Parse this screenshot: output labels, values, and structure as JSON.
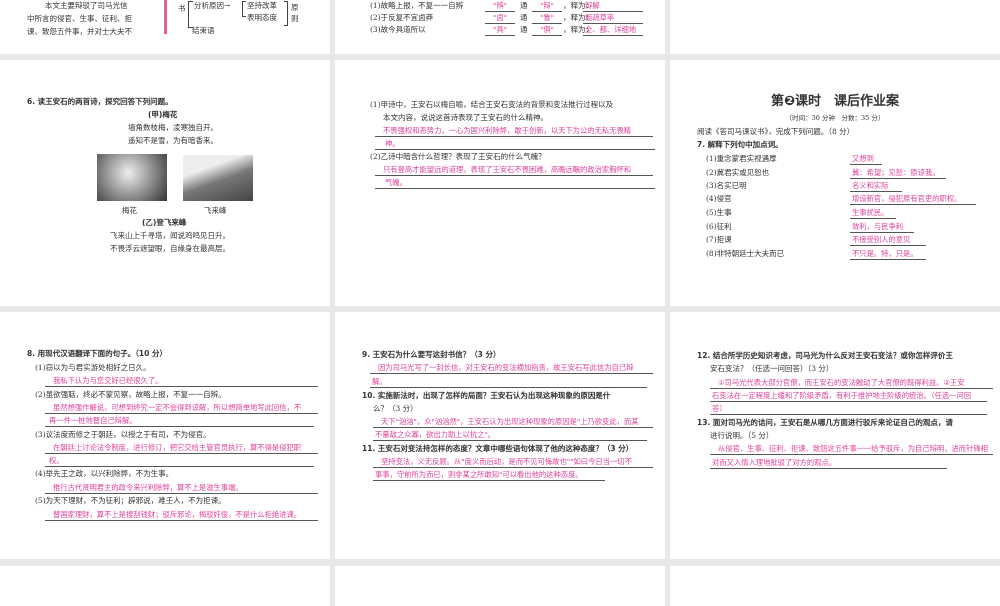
{
  "p1": {
    "lines": [
      "本文主要辩驳了司马光信",
      "中所言的侵官、生事、征利、拒",
      "谏、致怨五件事，并对士大夫不"
    ],
    "diagram": {
      "book": "书",
      "analyze": "分析原因→",
      "persist": "坚持改革",
      "attitude": "表明态度",
      "principle_1": "原",
      "principle_2": "则",
      "ending": "结束语"
    }
  },
  "p2": {
    "rows": [
      {
        "q": "(1)故略上报，不复一一自辨",
        "a": "\"辨\"",
        "tong": "通",
        "b": "\"辩\"",
        "shi": "，释为：",
        "ans": "辩解"
      },
      {
        "q": "(2)于反复不宜卤莽",
        "a": "\"卤\"",
        "tong": "通",
        "b": "\"鲁\"",
        "shi": "，释为：",
        "ans": "粗疏草率"
      },
      {
        "q": "(3)故今具道所以",
        "a": "\"具\"",
        "tong": "通",
        "b": "\"俱\"",
        "shi": "，释为：",
        "ans": "全、都、详细地"
      }
    ]
  },
  "p3": {
    "q": "6. 读王安石的两首诗，探究回答下列问题。",
    "poem1_title": "(甲)梅花",
    "poem1": [
      "墙角数枝梅，凌寒独自开。",
      "遥知不是雪，为有暗香来。"
    ],
    "cap1": "梅花",
    "cap2": "飞来峰",
    "poem2_title": "(乙)登飞来峰",
    "poem2": [
      "飞来山上千寻塔，闻说鸡鸣见日升。",
      "不畏浮云遮望眼，自缘身在最高层。"
    ]
  },
  "p4": {
    "q1": [
      "(1)甲诗中，王安石以梅自喻，结合王安石变法的背景和变法推行过程以及",
      "本文内容，说说这首诗表现了王安石的什么精神。"
    ],
    "a1": [
      "不畏强权和恶势力，一心为国兴利除弊，敢于创新，以天下为公的无私无畏精",
      "神。"
    ],
    "q2": "(2)乙诗中暗含什么哲理？表现了王安石的什么气魄？",
    "a2": [
      "只有登高才能望远的道理，表现了王安石不畏困难，高瞻远瞩的政治家胸怀和",
      "气魄。"
    ]
  },
  "p5": {
    "title": "第❷课时　课后作业案",
    "time": "（时间：30 分钟　分数：35 分）",
    "intro": "阅读《答司马谏议书》，完成下列问题。（8 分）",
    "q7": "7. 解释下列句中加点词。",
    "items": [
      {
        "q": "(1)重念蒙君实视遇厚",
        "a": "又想到"
      },
      {
        "q": "(2)冀君实或见恕也",
        "a": "冀：希望；见恕：原谅我。"
      },
      {
        "q": "(3)名实已明",
        "a": "名义和实际"
      },
      {
        "q": "(4)侵官",
        "a": "增设新官，侵犯原有官吏的职权。"
      },
      {
        "q": "(5)生事",
        "a": "生事扰民。"
      },
      {
        "q": "(6)征利",
        "a": "敛利，与民争利"
      },
      {
        "q": "(7)拒谏",
        "a": "不接受别人的意见"
      },
      {
        "q": "(8)非特朝廷士大夫而已",
        "a": "不只是。特，只是。"
      }
    ]
  },
  "p6": {
    "q8": "8. 用现代汉语翻译下面的句子。（10 分）",
    "s1": "(1)窃以为与君实游处相好之日久。",
    "a1": "我私下认为与您交好已经很久了。",
    "s2": "(2)虽欲强聒，终必不蒙见察，故略上报，不复一一自辨。",
    "a2": [
      "虽然想强作解说，可想到终究一定不会得到谅解，所以想简单地写此回信，不",
      "再一件一桩地替自己辩解。"
    ],
    "s3": "(3)议法度而修之于朝廷，以授之于有司，不为侵官。",
    "a3": [
      "在朝廷上讨论法令制度，进行修订，把它交给主管官员执行，算不得是侵犯职",
      "权。"
    ],
    "s4": "(4)举先王之政，以兴利除弊，不为生事。",
    "a4": "推行古代贤明君主的政令来兴利除弊，算不上是滋生事端。",
    "s5": "(5)为天下理财，不为征利；辟邪说，难壬人，不为拒谏。",
    "a5": "替国家理财，算不上是搜刮钱财；驳斥邪论，揭驳奸佞，不是什么拒绝进谏。"
  },
  "p7": {
    "q9": "9. 王安石为什么要写这封书信？（3 分）",
    "a9": [
      "因为司马光写了一封长信，对王安石的变法横加指责，故王安石写此信为自己辩",
      "解。"
    ],
    "q10": [
      "10. 实施新法时，出现了怎样的局面？王安石认为出现这种现象的原因是什",
      "么？（3 分）"
    ],
    "a10": [
      "天下\"汹汹\"，众\"汹汹然\"，王安石认为出现这种现象的原因是\"上乃欲变此，而某",
      "不量敌之众寡，欲出力助上以抗之\"。"
    ],
    "q11": "11. 王安石对变法持怎样的态度？文章中哪些语句体现了他的这种态度？（3 分）",
    "a11": [
      "坚持变法，义无反顾。从\"度义而后动，是而不见可悔故也\"\"如曰今日当一切不",
      "事事，守前所为而已，则非某之所敢知\"可以看出他的这种态度。"
    ]
  },
  "p8": {
    "q12": [
      "12. 结合所学历史知识考虑，司马光为什么反对王安石变法？或你怎样评价王",
      "安石变法？（任选一问回答）（3 分）"
    ],
    "a12": [
      "①司马光代表大部分官僚，而王安石的变法触动了大官僚的既得利益。②王安",
      "石变法在一定程度上缓和了阶级矛盾，有利于维护地主阶级的统治。（任选一问回",
      "答）"
    ],
    "q13": [
      "13. 面对司马光的诘问，王安石是从哪几方面进行驳斥来论证自己的观点，请",
      "进行说明。（5 分）"
    ],
    "a13": [
      "从侵官、生事、征利、拒谏、致怨这五件事一一给予驳斥，为自己辩明，进而针锋相",
      "对而又入情入理地批驳了对方的观点。"
    ]
  }
}
